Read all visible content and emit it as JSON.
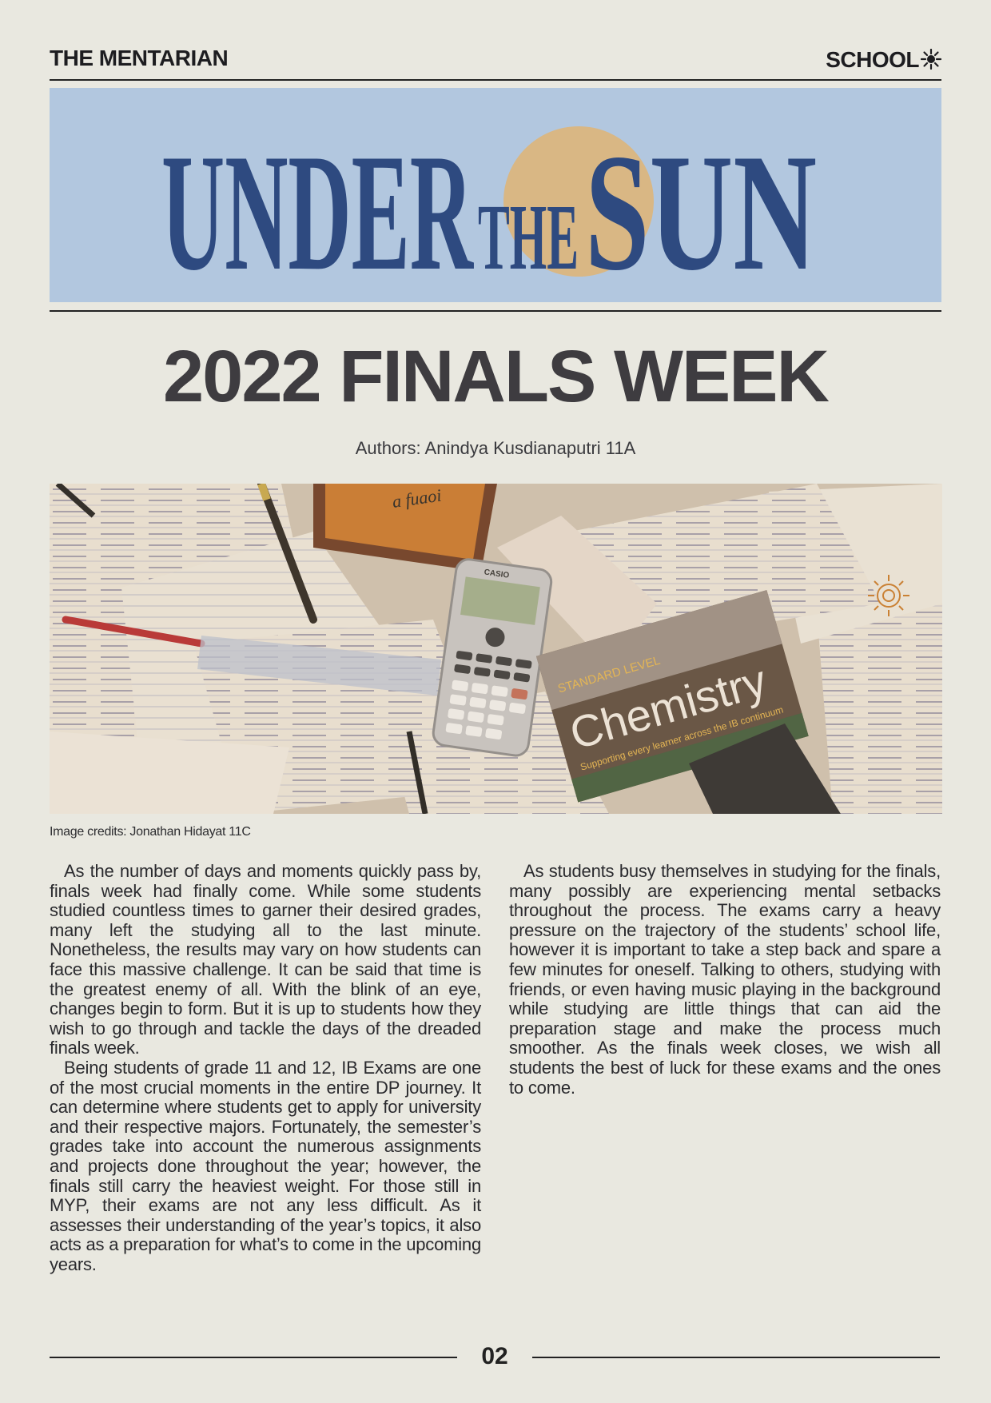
{
  "header": {
    "publication": "THE MENTARIAN",
    "section": "SCHOOL"
  },
  "masthead": {
    "title_word_1": "UNDER",
    "title_word_2": "THE",
    "title_word_3": "SUN"
  },
  "article": {
    "headline": "2022 FINALS WEEK",
    "authors": "Authors: Anindya Kusdianaputri 11A",
    "image_credit": "Image credits: Jonathan Hidayat 11C",
    "photo_labels": {
      "book_title": "Chemistry",
      "book_level": "STANDARD LEVEL",
      "book_tagline": "Supporting every learner across the IB continuum",
      "calculator_brand": "CASIO",
      "novel_title": "a fuaoi"
    },
    "paragraphs_left": [
      "As the number of days and moments quickly pass by, finals week had finally come. While some students studied countless times to garner their desired grades, many left the studying all to the last minute. Nonetheless, the results may vary on how students can face this massive challenge. It can be said that time is the greatest enemy of all. With the blink of an eye, changes begin to form. But it is up to students how they wish to go through and tackle the days of the dreaded finals week.",
      "Being students of grade 11 and 12, IB Exams are one of the most crucial moments in the entire DP journey. It can determine where students get to apply for university and their respective majors. Fortunately, the semester’s grades take into account the numerous assignments and projects done throughout the year; however, the finals still carry the heaviest weight. For those still in MYP, their exams are not any less difficult. As it assesses their understanding of the year’s topics, it also acts as a preparation for what’s to come in the upcoming years."
    ],
    "paragraphs_right": [
      "As students busy themselves in studying for the finals, many possibly are experiencing mental setbacks throughout the process. The exams carry a heavy pressure on the trajectory of the students’ school life, however it is important to take a step back and spare a few minutes for oneself. Talking to others, studying with friends, or even having music playing in the background while studying are little things that can aid the preparation stage and make the process much smoother. As the finals week closes, we wish all students the best of luck for these exams and the ones to come."
    ]
  },
  "footer": {
    "page_number": "02"
  },
  "colors": {
    "masthead_bg": "#b2c7df",
    "masthead_text": "#2e4a80",
    "sun": "#d9b784",
    "paper": "#e9e8e0"
  }
}
